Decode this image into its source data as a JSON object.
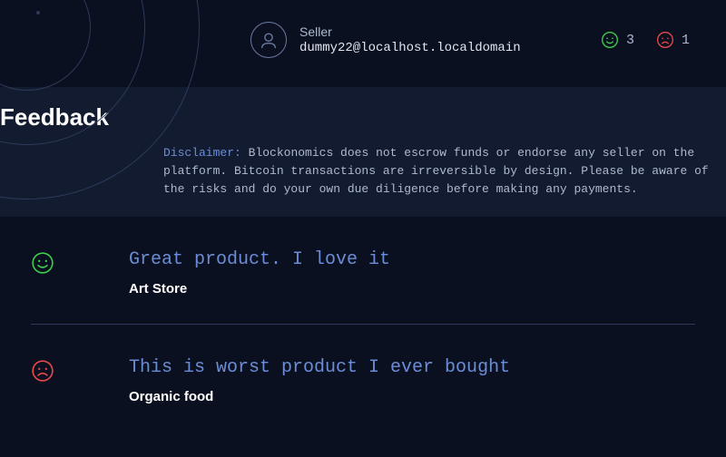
{
  "header": {
    "seller_label": "Seller",
    "seller_email": "dummy22@localhost.localdomain",
    "positive_count": "3",
    "negative_count": "1"
  },
  "section": {
    "title": "Feedback",
    "disclaimer_tag": "Disclaimer:",
    "disclaimer_text": "Blockonomics does not escrow funds or endorse any seller on the platform. Bitcoin transactions are irreversible by design. Please be aware of the risks and do your own due diligence before making any payments."
  },
  "reviews": [
    {
      "mood": "positive",
      "comment": "Great product. I love it",
      "product": "Art Store"
    },
    {
      "mood": "negative",
      "comment": "This is worst product I ever bought",
      "product": "Organic food"
    }
  ],
  "colors": {
    "positive": "#3ecf4a",
    "negative": "#e84a4a"
  }
}
